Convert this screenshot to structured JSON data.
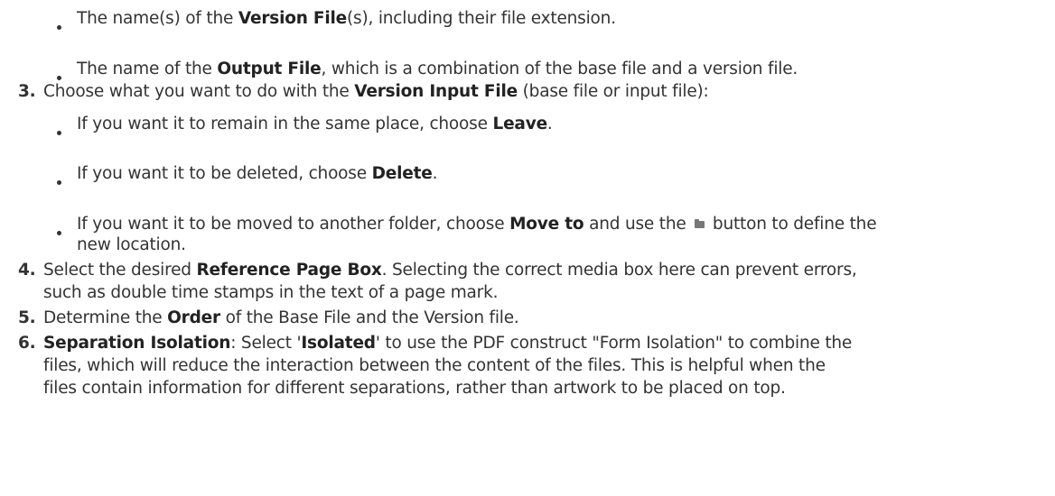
{
  "items": {
    "b1": {
      "pre": "The name(s) of the ",
      "bold": "Version File",
      "post": "(s), including their file extension."
    },
    "b2": {
      "pre": "The name of the ",
      "bold": "Output File",
      "post": ", which is a combination of the base file and a version file."
    },
    "s3": {
      "num": "3.",
      "pre": "Choose what you want to do with the ",
      "bold": "Version Input File",
      "post": " (base file or input file):"
    },
    "b4": {
      "pre": "If you want it to remain in the same place, choose ",
      "bold": "Leave",
      "post": "."
    },
    "b5": {
      "pre": "If you want it to be deleted, choose ",
      "bold": "Delete",
      "post": "."
    },
    "b6": {
      "pre": "If you want it to be moved to another folder, choose ",
      "bold": "Move to",
      "mid": " and use the ",
      "post": " button to define the",
      "line2": "new location."
    },
    "s4": {
      "num": "4.",
      "pre": "Select the desired ",
      "bold": "Reference Page Box",
      "post": ". Selecting the correct media box here can prevent errors,",
      "line2": "such as double time stamps in the text of a page mark."
    },
    "s5": {
      "num": "5.",
      "pre": "Determine the ",
      "bold": "Order",
      "post": " of the Base File and the Version file."
    },
    "s6": {
      "num": "6.",
      "bold": "Separation Isolation",
      "mid": ": Select '",
      "bold2": "Isolated",
      "post": "' to use the PDF construct \"Form Isolation\" to combine the",
      "line2": "files, which will reduce the interaction between the content of the files. This is helpful when the",
      "line3": "files contain information for different separations, rather than artwork to be placed on top."
    }
  }
}
